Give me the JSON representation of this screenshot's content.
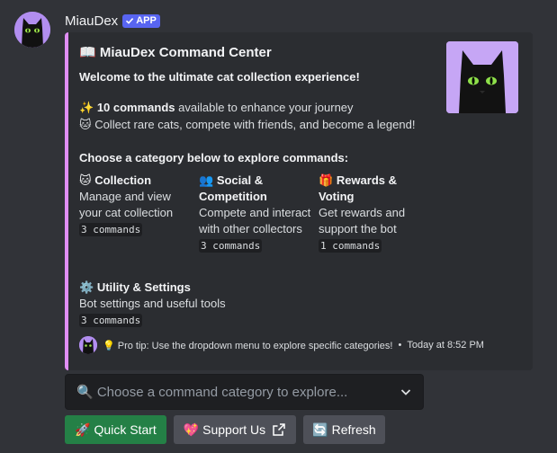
{
  "message": {
    "username": "MiauDex",
    "badge": "APP"
  },
  "embed": {
    "title": "📖 MiauDex Command Center",
    "subtitle": "Welcome to the ultimate cat collection experience!",
    "line1_icon": "✨",
    "line1_bold": "10 commands",
    "line1_rest": " available to enhance your journey",
    "line2_icon": "🐱",
    "line2_text": "Collect rare cats, compete with friends, and become a legend!",
    "choose": "Choose a category below to explore commands:",
    "fields": [
      {
        "icon": "🐱",
        "name": "Collection",
        "desc": "Manage and view your cat collection",
        "count": "3 commands"
      },
      {
        "icon": "👥",
        "name": "Social & Competition",
        "desc": "Compete and interact with other collectors",
        "count": "3 commands"
      },
      {
        "icon": "🎁",
        "name": "Rewards & Voting",
        "desc": "Get rewards and support the bot",
        "count": "1 commands"
      },
      {
        "icon": "⚙️",
        "name": "Utility & Settings",
        "desc": "Bot settings and useful tools",
        "count": "3 commands"
      }
    ],
    "footer_text": "💡 Pro tip: Use the dropdown menu to explore specific categories!",
    "footer_sep": "•",
    "footer_time": "Today at 8:52 PM"
  },
  "select": {
    "placeholder": "🔍 Choose a command category to explore..."
  },
  "buttons": {
    "quick_start": "🚀 Quick Start",
    "support": "💖 Support Us",
    "refresh": "🔄 Refresh"
  },
  "colors": {
    "background": "#313338",
    "embed_bg": "#2b2d31",
    "embed_accent": "#e08ef4",
    "app_badge": "#5865f2",
    "success_button": "#248046",
    "secondary_button": "#4e5058"
  },
  "icons": {
    "avatar": "black-cat-avatar",
    "thumbnail": "black-cat-thumbnail",
    "badge": "checkmark-icon",
    "select": "chevron-down-icon",
    "support": "external-link-icon"
  }
}
